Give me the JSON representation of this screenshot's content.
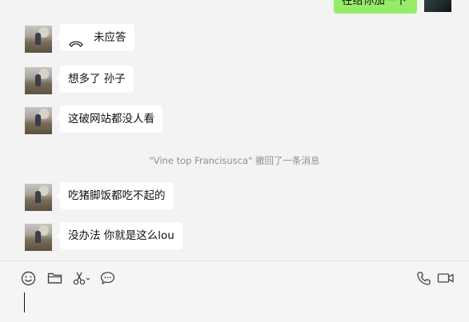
{
  "colors": {
    "background": "#f3f3f3",
    "incoming_bubble": "#ffffff",
    "outgoing_bubble": "#95ec69",
    "system_text": "#8f8f8f"
  },
  "outgoing": {
    "text": "在给你加一下"
  },
  "messages": [
    {
      "text": "未应答",
      "icon": "phone-hangup-icon"
    },
    {
      "text": "想多了 孙子"
    },
    {
      "text": "这破网站都没人看"
    },
    {
      "text": "吃猪脚饭都吃不起的"
    },
    {
      "text": "没办法 你就是这么lou"
    }
  ],
  "system_note": {
    "quoted_name": "\"Vine top Francisusca\"",
    "action": " 撤回了一条消息"
  },
  "toolbar": {
    "left": [
      "emoji-icon",
      "folder-icon",
      "scissors-icon",
      "chat-bubble-icon"
    ],
    "right": [
      "phone-icon",
      "video-call-icon"
    ]
  }
}
